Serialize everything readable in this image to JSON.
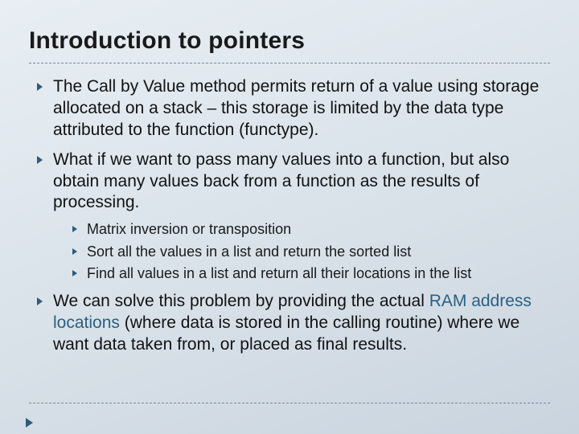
{
  "title": "Introduction to pointers",
  "bullets": {
    "b1": "The Call by Value method permits return of a value using storage allocated on a stack – this storage is limited by the data type attributed to the function (functype).",
    "b2": "What if we want to pass many values into a function, but also obtain many values back from a function as the results of processing.",
    "sub": {
      "s1": "Matrix inversion or transposition",
      "s2": "Sort all the values in a list and return the sorted list",
      "s3": "Find all values in a list and return all their locations in the list"
    },
    "b3_pre": "We can solve this problem by providing the actual ",
    "b3_accent": "RAM address locations",
    "b3_post": " (where data is stored in the calling routine) where we want data taken from, or placed as final results."
  }
}
